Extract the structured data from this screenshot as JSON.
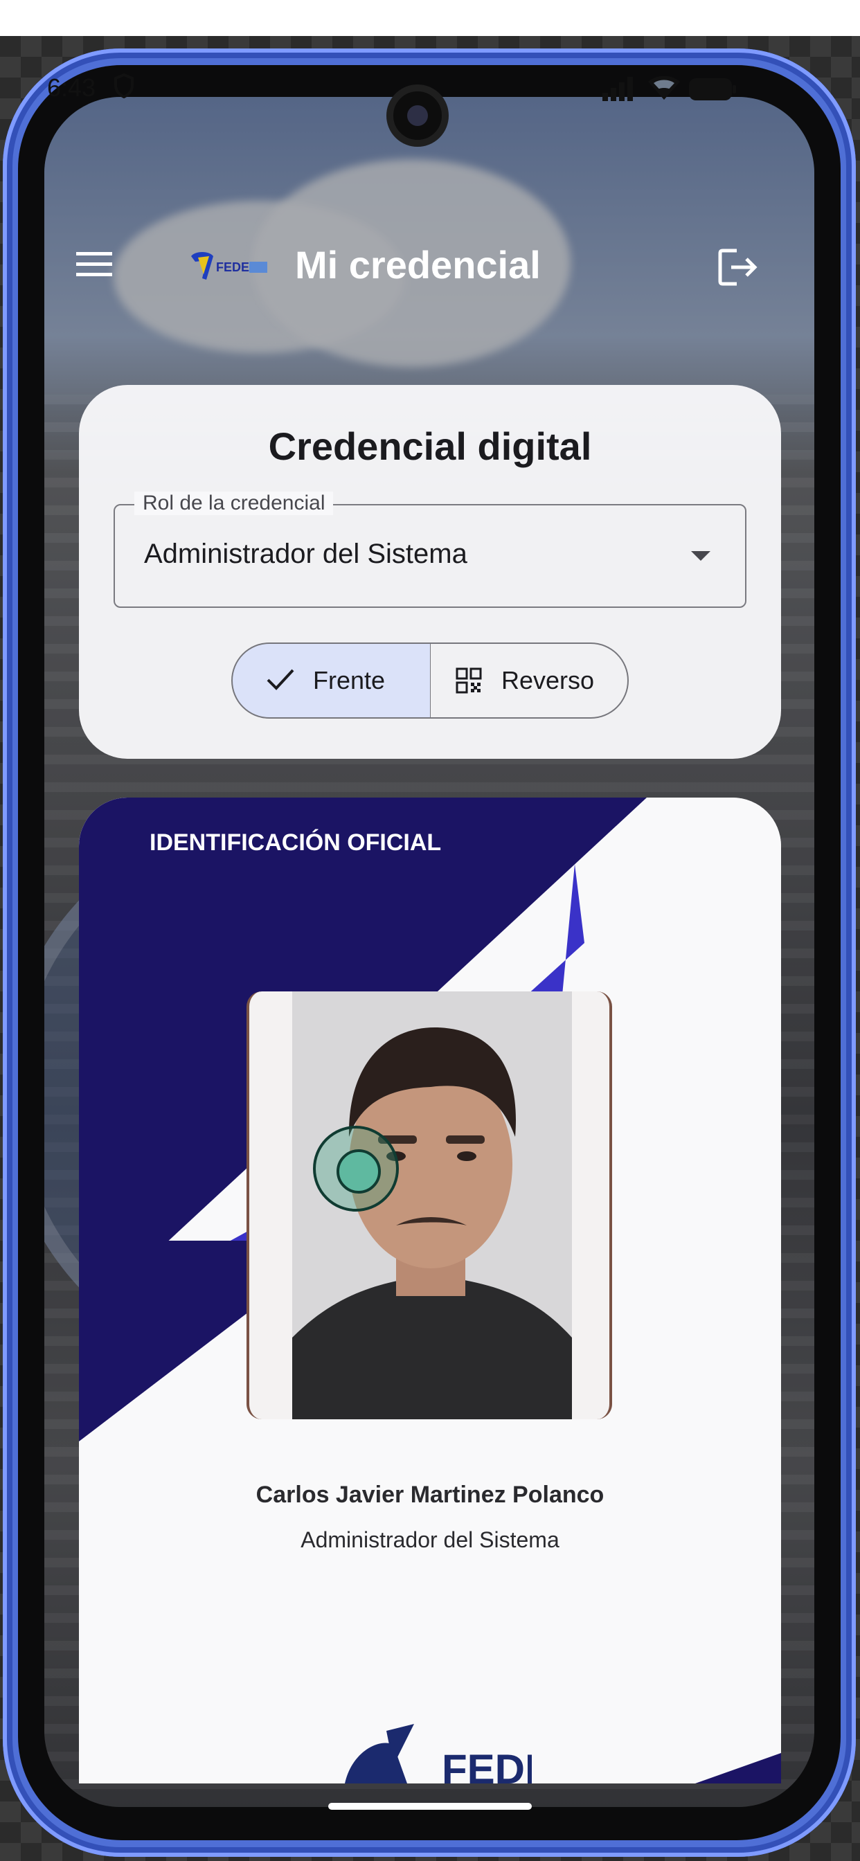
{
  "status_bar": {
    "time": "6:43",
    "icons": [
      "shield-icon",
      "signal-icon",
      "wifi-icon",
      "battery-icon"
    ]
  },
  "app_bar": {
    "title": "Mi credencial",
    "menu_icon": "menu-icon",
    "logo_text": "FEDE",
    "logout_icon": "logout-icon"
  },
  "credential_selector": {
    "title": "Credencial digital",
    "field_label": "Rol de la credencial",
    "selected_role": "Administrador del Sistema",
    "segments": [
      {
        "label": "Frente",
        "selected": true,
        "icon": "check-icon"
      },
      {
        "label": "Reverso",
        "selected": false,
        "icon": "qr-icon"
      }
    ]
  },
  "credential_card": {
    "header": "IDENTIFICACIÓN OFICIAL",
    "name": "Carlos Javier Martinez Polanco",
    "role": "Administrador del Sistema",
    "footer_logo_text": "FEDE"
  },
  "colors": {
    "card_navy": "#1b1464",
    "card_accent": "#3a32c8",
    "segment_selected_bg": "#dbe2f9",
    "device_frame": "#4f6fd6"
  }
}
